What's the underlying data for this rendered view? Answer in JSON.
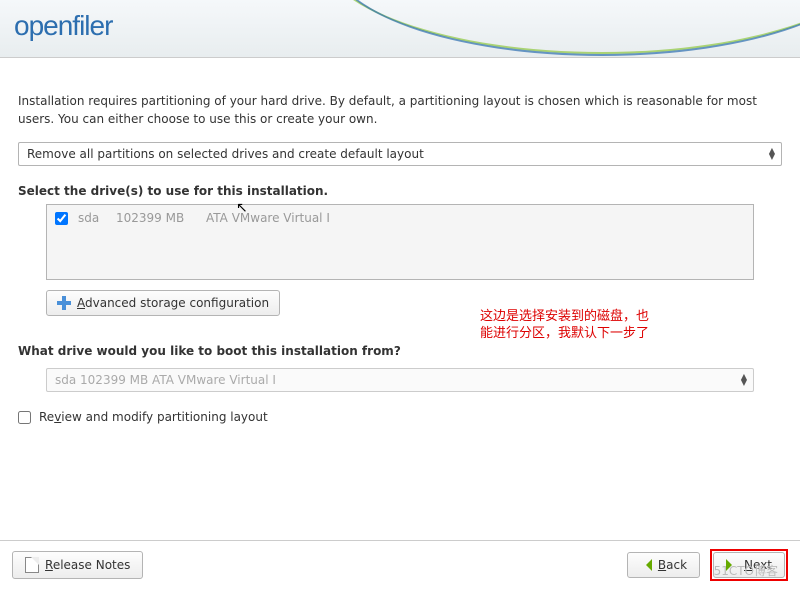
{
  "header": {
    "logo": "openfiler"
  },
  "intro": "Installation requires partitioning of your hard drive.  By default, a partitioning layout is chosen which is reasonable for most users. You can either choose to use this or create your own.",
  "layout_combo": {
    "selected": "Remove all partitions on selected drives and create default layout"
  },
  "drives_label": "Select the drive(s) to use for this installation.",
  "drives": [
    {
      "checked": true,
      "name": "sda",
      "size": "102399 MB",
      "model": "ATA VMware Virtual I"
    }
  ],
  "advanced_btn": {
    "prefix": "A",
    "rest": "dvanced storage configuration"
  },
  "annotation": "这边是选择安装到的磁盘，也\n能进行分区，我默认下一步了",
  "boot_label": "What drive would you like to boot this installation from?",
  "boot_combo": {
    "selected": "sda   102399 MB ATA VMware Virtual I"
  },
  "review_cb": {
    "checked": false,
    "prefix": "Re",
    "ul": "v",
    "rest": "iew and modify partitioning layout"
  },
  "footer": {
    "release_notes": {
      "ul": "R",
      "rest": "elease Notes"
    },
    "back": {
      "ul": "B",
      "rest": "ack"
    },
    "next": {
      "ul": "N",
      "rest": "ext"
    }
  },
  "watermark": "51CTO博客"
}
